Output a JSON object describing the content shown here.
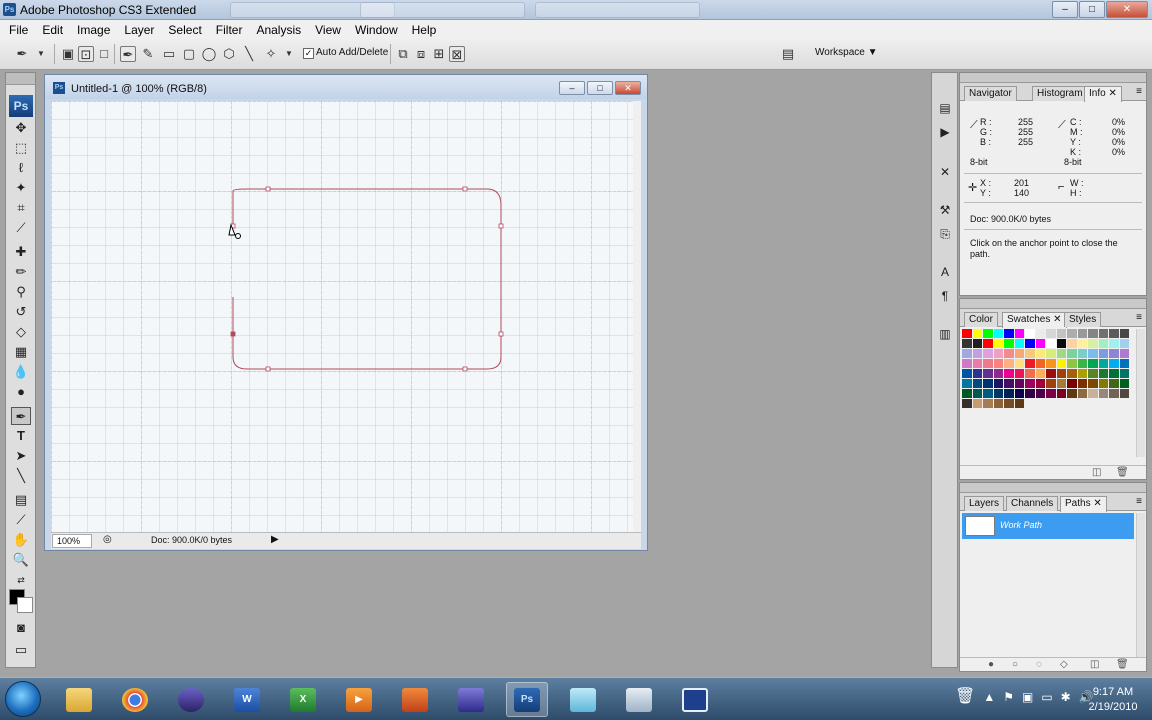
{
  "window": {
    "title": "Adobe Photoshop CS3 Extended",
    "controls": {
      "minimize": "–",
      "maximize": "□",
      "close": "✕"
    }
  },
  "menu": [
    "File",
    "Edit",
    "Image",
    "Layer",
    "Select",
    "Filter",
    "Analysis",
    "View",
    "Window",
    "Help"
  ],
  "options_bar": {
    "auto_add_delete_label": "Auto Add/Delete",
    "auto_add_delete_checked": true,
    "workspace_label": "Workspace ▼"
  },
  "toolbox": {
    "logo": "Ps",
    "tools": [
      "move-icon",
      "marquee-icon",
      "lasso-icon",
      "magic-wand-icon",
      "crop-icon",
      "slice-icon",
      "healing-icon",
      "brush-icon",
      "clone-stamp-icon",
      "history-brush-icon",
      "eraser-icon",
      "gradient-icon",
      "blur-icon",
      "dodge-icon",
      "pen-icon",
      "type-icon",
      "path-select-icon",
      "line-icon",
      "notes-icon",
      "eyedropper-icon",
      "hand-icon",
      "zoom-icon"
    ],
    "active_tool": "pen-icon",
    "type_glyph": "T"
  },
  "document": {
    "title": "Untitled-1 @ 100% (RGB/8)",
    "zoom": "100%",
    "doc_info": "Doc: 900.0K/0 bytes",
    "grid_color": "#a9c3e6",
    "path_color": "#b04a5a"
  },
  "info_panel": {
    "tabs": [
      "Navigator",
      "Histogram",
      "Info"
    ],
    "active_tab": "Info",
    "rgb": {
      "r_label": "R :",
      "r": "255",
      "g_label": "G :",
      "g": "255",
      "b_label": "B :",
      "b": "255"
    },
    "cmyk": {
      "c_label": "C :",
      "c": "0%",
      "m_label": "M :",
      "m": "0%",
      "y_label": "Y :",
      "y": "0%",
      "k_label": "K :",
      "k": "0%"
    },
    "bit_left": "8-bit",
    "bit_right": "8-bit",
    "coords": {
      "x_label": "X :",
      "x": "201",
      "y_label": "Y :",
      "y": "140"
    },
    "size": {
      "w_label": "W :",
      "h_label": "H :"
    },
    "doc_info": "Doc: 900.0K/0 bytes",
    "hint": "Click on the anchor point to close the path."
  },
  "swatches_panel": {
    "tabs": [
      "Color",
      "Swatches",
      "Styles"
    ],
    "active_tab": "Swatches",
    "colors": [
      "#ff0000",
      "#ffff00",
      "#00ff00",
      "#00ffff",
      "#0000ff",
      "#ff00ff",
      "#ffffff",
      "#ebebeb",
      "#d6d6d6",
      "#c2c2c2",
      "#adadad",
      "#999999",
      "#858585",
      "#707070",
      "#5c5c5c",
      "#474747",
      "#333333",
      "#1f1f1f",
      "#ff0000",
      "#ffff00",
      "#00ff00",
      "#00ffff",
      "#0000ff",
      "#ff00ff",
      "#ffffff",
      "#0a0a0a",
      "#ffd0a0",
      "#fff0a0",
      "#d8f0a0",
      "#a0f0c0",
      "#a0f0f0",
      "#a0d0f0",
      "#a0a8e0",
      "#c0a0e0",
      "#e0a0e0",
      "#f0a0c0",
      "#f28c8c",
      "#f5a97a",
      "#f8c97a",
      "#fbe97a",
      "#d9ec7a",
      "#9cdc7a",
      "#7ad49a",
      "#7acdc8",
      "#7abdec",
      "#7a9ce0",
      "#8c84d4",
      "#ac7ad0",
      "#cf7ac8",
      "#ea7aa8",
      "#ee7a8c",
      "#ff8080",
      "#ffb080",
      "#ffe080",
      "#ed1c24",
      "#f26522",
      "#f7941d",
      "#fff200",
      "#8dc63f",
      "#39b54a",
      "#00a651",
      "#00a99d",
      "#00aeef",
      "#0072bc",
      "#0054a6",
      "#2e3192",
      "#662d91",
      "#92278f",
      "#ec008c",
      "#ed145b",
      "#f26c4f",
      "#fbaf5d",
      "#9e0b0f",
      "#a0410d",
      "#a36209",
      "#aba000",
      "#598527",
      "#1a7b30",
      "#007236",
      "#00746b",
      "#0076a3",
      "#004b80",
      "#003471",
      "#1b1464",
      "#440e62",
      "#630460",
      "#9e005d",
      "#9e0039",
      "#a0410d",
      "#a37c3a",
      "#790000",
      "#7b2e00",
      "#7d4900",
      "#827b00",
      "#406618",
      "#005e20",
      "#005826",
      "#005952",
      "#005b7f",
      "#003663",
      "#002157",
      "#0d004c",
      "#32004b",
      "#4b0049",
      "#7b0046",
      "#7a0026",
      "#603913",
      "#8b6b3f",
      "#c7b299",
      "#998675",
      "#736357",
      "#534741",
      "#362f2d",
      "#c69c6d",
      "#a67c52",
      "#8c6239",
      "#754c24",
      "#603913"
    ]
  },
  "paths_panel": {
    "tabs": [
      "Layers",
      "Channels",
      "Paths"
    ],
    "active_tab": "Paths",
    "items": [
      "Work Path"
    ]
  },
  "taskbar": {
    "apps": [
      "Windows Explorer",
      "Google Chrome",
      "Eclipse",
      "Microsoft Word",
      "Microsoft Excel",
      "Media Player",
      "Office App",
      "Visual Studio",
      "Adobe Photoshop",
      "Notepad",
      "Calculator",
      "Remote Desktop"
    ],
    "active_app": "Adobe Photoshop",
    "ps_label": "Ps",
    "time": "9:17 AM",
    "date": "2/19/2010"
  }
}
